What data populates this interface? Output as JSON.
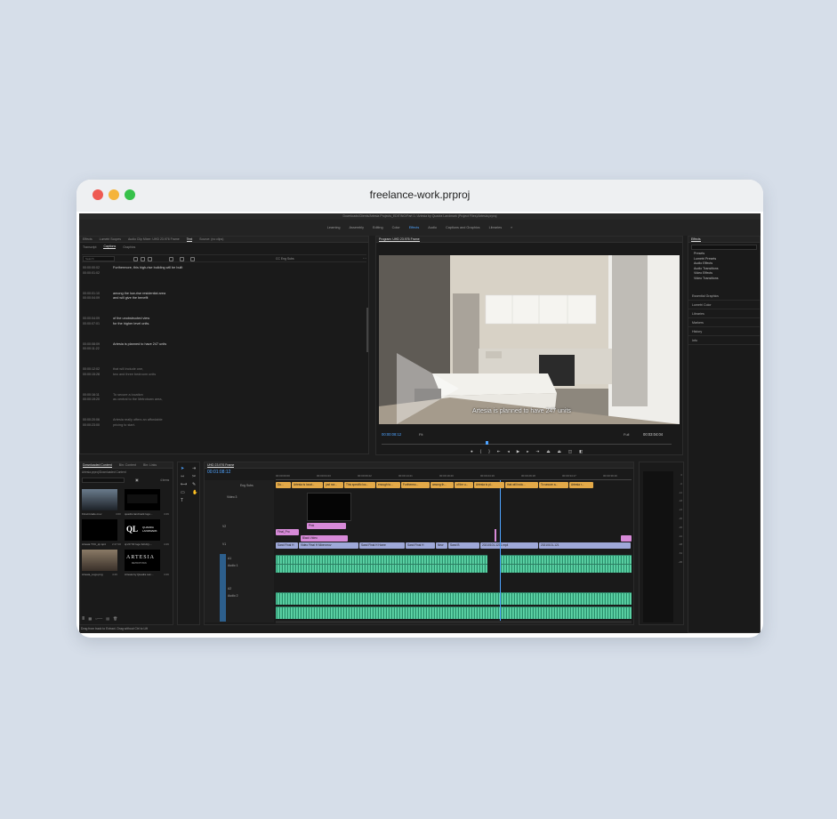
{
  "window": {
    "title": "freelance-work.prproj"
  },
  "app": {
    "path": "Downloads/Clients/Artesia Projects_EDITING/Part 1 / Artesia by Quadra Landmark (Project FIles)/Artesia.prproj",
    "workspaces": [
      "Learning",
      "Assembly",
      "Editing",
      "Color",
      "Effects",
      "Audio",
      "Captions and Graphics",
      "Libraries"
    ],
    "active_workspace": "Effects",
    "workspace_menu": "»"
  },
  "left_panel": {
    "tabs": [
      "Effects",
      "Lumetri Scopes",
      "Audio Clip Mixer: UHD 23.976 Frame",
      "Text",
      "Source: (no clips)"
    ],
    "subtabs": [
      "Transcript",
      "Captions",
      "Graphics"
    ],
    "search_placeholder": "Search",
    "track_label": "CC Eng Subs",
    "captions": [
      {
        "tc": "00:00:00:02\n00:00:01:02",
        "text": "Furthermore, this high-rise building will be built"
      },
      {
        "tc": "00:00:01:10\n00:00:04:09",
        "text": "among the low-rise residential area\nand will give the benefit"
      },
      {
        "tc": "00:00:04:09\n00:00:07:01",
        "text": "of the unobstructed view\nfor the higher level units."
      },
      {
        "tc": "00:00:08:09\n00:00:11:22",
        "text": "Artesia is planned to have 247 units"
      },
      {
        "tc": "00:00:12:02\n00:00:15:28",
        "text": "that will include one,\ntwo and three bedroom units"
      },
      {
        "tc": "00:00:16:11\n00:00:19:20",
        "text": "To secure a location\nas central to the Metrotown area,"
      },
      {
        "tc": "00:00:20:06\n00:00:23:00",
        "text": "Artesia really offers an affordable\npricing to start."
      }
    ]
  },
  "program_monitor": {
    "tab": "Program: UHD 23.976 Frame",
    "caption_overlay": "Artesia is planned to have 247 units",
    "timecode": "00:00:08:12",
    "fit": "Fit",
    "quality": "Full",
    "duration": "00:03:04:04"
  },
  "effects_panel": {
    "title": "Effects",
    "items": [
      "Presets",
      "Lumetri Presets",
      "Audio Effects",
      "Audio Transitions",
      "Video Effects",
      "Video Transitions"
    ],
    "links": [
      "Essential Graphics",
      "Lumetri Color",
      "Libraries",
      "Markers",
      "History",
      "Info"
    ]
  },
  "project_panel": {
    "tabs": [
      "Downloaded Content",
      "Bin: Content",
      "Bin: Links"
    ],
    "path": "Artesia.prproj\\Downloaded Content",
    "count": "4 items",
    "items": [
      {
        "name": "Final-Grade.mov",
        "duration": "4:00"
      },
      {
        "name": "quadra landmark logo...",
        "duration": "4:29"
      },
      {
        "name": "ql 20 YR logo full AQ-...",
        "duration": "4:29"
      },
      {
        "name": "Artesia by Quadra Lan...",
        "duration": "4:29"
      },
      {
        "name": "Artesia TVC_ql.mp4",
        "duration": "2:27:00"
      },
      {
        "name": "Artesia_Logo.png",
        "duration": "4:29"
      }
    ],
    "logo_ql": "QL",
    "logo_ql_text": "QUADRA\nLANDMARK",
    "logo_artesia": "ARTESIA",
    "logo_artesia_sub": "METROTOWN"
  },
  "timeline": {
    "tab": "UHD 23.976 Frame",
    "timecode": "00:01:08:12",
    "ruler": [
      "00:00:00:00",
      "00:00:04:23",
      "00:00:09:22",
      "00:00:14:21",
      "00:00:19:20",
      "00:00:24:19",
      "00:00:29:18",
      "00:00:34:17",
      "00:00:39:16",
      "00:"
    ],
    "tracks": [
      "Eng Subs",
      "Video 3",
      "V2",
      "V1",
      "A1",
      "Audio 1",
      "A2",
      "Audio 2"
    ],
    "caption_clips": [
      "Du...",
      "Artesia is locat...",
      "just nor...",
      "This specific loc...",
      "enough to...",
      "Furthermo...",
      "among th...",
      "of the u...",
      "Artesia is pl...",
      "that will inclu...",
      "To secure a...",
      "Artesia r..."
    ],
    "clips": {
      "v3": "Final_Pro",
      "v2a": "Pink",
      "v2b": "Black Video",
      "v1": [
        "Sand Final H",
        "Video Final H Mixer.mov",
        "Sand Final H Home",
        "Sand Final H",
        "New",
        "Sand B",
        "20210101-1231.mp4",
        "20210101-121"
      ]
    }
  },
  "status": {
    "hint": "Drag from track to Extract. Drag without Ctrl to Lift"
  }
}
